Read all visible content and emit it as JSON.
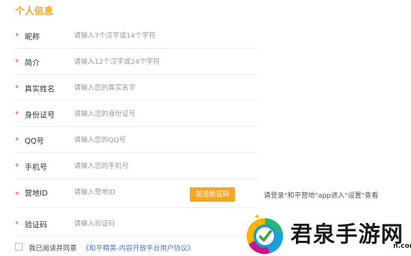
{
  "section_title": "个人信息",
  "fields": [
    {
      "label": "昵称",
      "placeholder": "请输入7个汉字或14个字符"
    },
    {
      "label": "简介",
      "placeholder": "请输入12个汉字或24个字符"
    },
    {
      "label": "真实姓名",
      "placeholder": "请输入您的真实名字"
    },
    {
      "label": "身份证号",
      "placeholder": "请输入您的身份证号"
    },
    {
      "label": "QQ号",
      "placeholder": "请输入您的QQ号"
    },
    {
      "label": "手机号",
      "placeholder": "请输入您的手机号"
    },
    {
      "label": "营地ID",
      "placeholder": "请输入营地ID"
    },
    {
      "label": "验证码",
      "placeholder": "请输入验证码"
    }
  ],
  "required_mark": "*",
  "send_code_button": "发送验证码",
  "camp_hint": "请登录\"和平营地\"app进入\"设置\"查看",
  "agreement": {
    "text": "我已阅读并同意",
    "link": "《和平精英-内容开放平台用户协议》"
  },
  "watermark": {
    "brand": "君泉手游网",
    "small": "n.com"
  },
  "colors": {
    "accent": "#f5a623",
    "required": "#e64340",
    "link": "#4a76c9"
  }
}
